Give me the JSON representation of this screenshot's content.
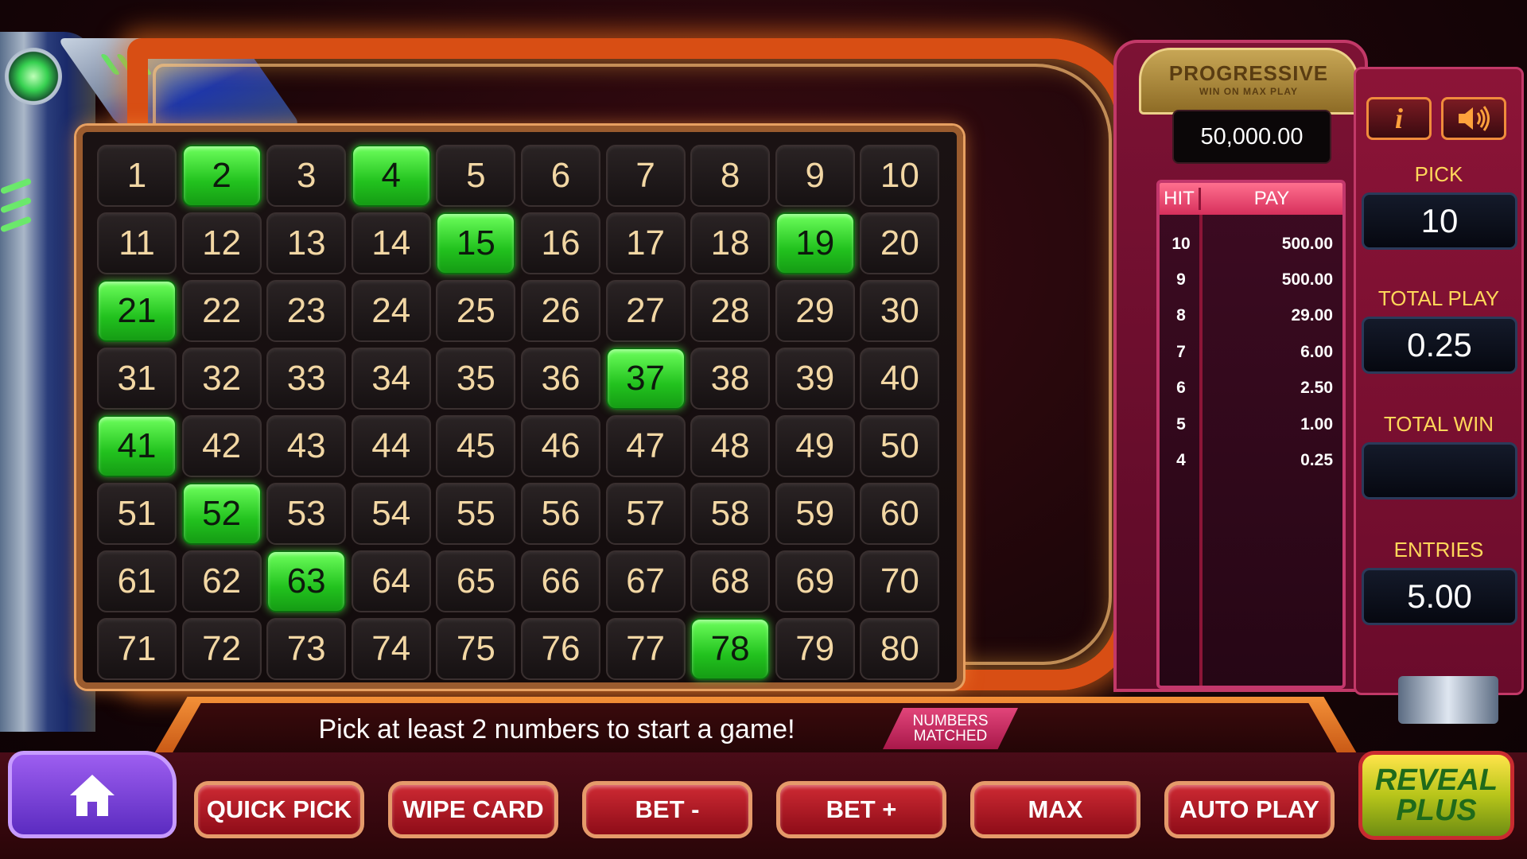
{
  "board": {
    "numbers": [
      1,
      2,
      3,
      4,
      5,
      6,
      7,
      8,
      9,
      10,
      11,
      12,
      13,
      14,
      15,
      16,
      17,
      18,
      19,
      20,
      21,
      22,
      23,
      24,
      25,
      26,
      27,
      28,
      29,
      30,
      31,
      32,
      33,
      34,
      35,
      36,
      37,
      38,
      39,
      40,
      41,
      42,
      43,
      44,
      45,
      46,
      47,
      48,
      49,
      50,
      51,
      52,
      53,
      54,
      55,
      56,
      57,
      58,
      59,
      60,
      61,
      62,
      63,
      64,
      65,
      66,
      67,
      68,
      69,
      70,
      71,
      72,
      73,
      74,
      75,
      76,
      77,
      78,
      79,
      80
    ],
    "picked": [
      2,
      4,
      15,
      19,
      21,
      37,
      41,
      52,
      63,
      78
    ],
    "picked_color": "#2fd42a"
  },
  "progressive": {
    "title": "PROGRESSIVE",
    "subtitle": "WIN ON MAX PLAY",
    "amount": "50,000.00"
  },
  "pay_table": {
    "hit_header": "HIT",
    "pay_header": "PAY",
    "rows": [
      {
        "hit": "10",
        "pay": "500.00"
      },
      {
        "hit": "9",
        "pay": "500.00"
      },
      {
        "hit": "8",
        "pay": "29.00"
      },
      {
        "hit": "7",
        "pay": "6.00"
      },
      {
        "hit": "6",
        "pay": "2.50"
      },
      {
        "hit": "5",
        "pay": "1.00"
      },
      {
        "hit": "4",
        "pay": "0.25"
      }
    ]
  },
  "info": {
    "info_icon": "info-icon",
    "sound_icon": "speaker-icon",
    "pick_label": "PICK",
    "pick_value": "10",
    "total_play_label": "TOTAL PLAY",
    "total_play_value": "0.25",
    "total_win_label": "TOTAL WIN",
    "total_win_value": "",
    "entries_label": "ENTRIES",
    "entries_value": "5.00"
  },
  "message": {
    "text": "Pick at least 2 numbers to start a game!",
    "matched_line1": "NUMBERS",
    "matched_line2": "MATCHED"
  },
  "buttons": {
    "home_icon": "home-icon",
    "quick_pick": "QUICK PICK",
    "wipe_card": "WIPE CARD",
    "bet_minus": "BET -",
    "bet_plus": "BET +",
    "max": "MAX",
    "auto_play": "AUTO PLAY",
    "reveal_line1": "REVEAL",
    "reveal_line2": "PLUS"
  }
}
